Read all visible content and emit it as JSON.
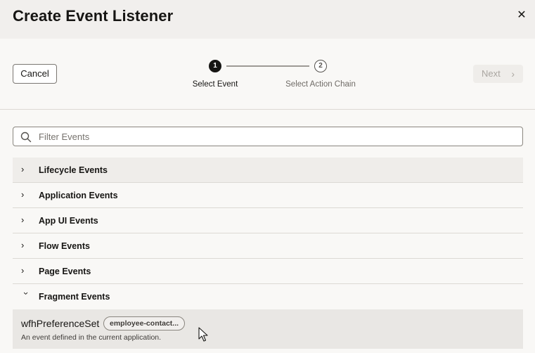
{
  "dialog": {
    "title": "Create Event Listener",
    "close_icon": "close-icon"
  },
  "wizard": {
    "cancel_label": "Cancel",
    "next_label": "Next",
    "steps": [
      {
        "number": "1",
        "label": "Select Event",
        "state": "active"
      },
      {
        "number": "2",
        "label": "Select Action Chain",
        "state": "pending"
      }
    ]
  },
  "filter": {
    "placeholder": "Filter Events",
    "value": ""
  },
  "categories": [
    {
      "label": "Lifecycle Events",
      "expanded": false
    },
    {
      "label": "Application Events",
      "expanded": false
    },
    {
      "label": "App UI Events",
      "expanded": false
    },
    {
      "label": "Flow Events",
      "expanded": false
    },
    {
      "label": "Page Events",
      "expanded": false
    },
    {
      "label": "Fragment Events",
      "expanded": true
    }
  ],
  "fragment_events": [
    {
      "name": "wfhPreferenceSet",
      "badge": "employee-contact...",
      "description": "An event defined in the current application."
    }
  ],
  "colors": {
    "title_bg": "#f1efed",
    "page_bg": "#f9f8f6",
    "active_step": "#161513",
    "row_hover": "#efedea",
    "selected_item": "#e9e7e4"
  }
}
